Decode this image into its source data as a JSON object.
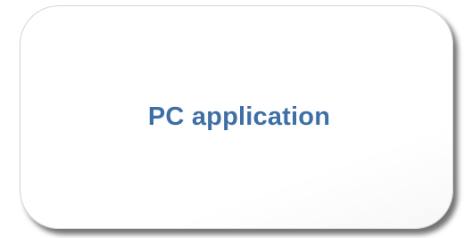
{
  "node": {
    "label": "PC application",
    "label_color": "#3e6fa6",
    "border_color": "#d4d4d4",
    "fill_color": "#ffffff"
  }
}
